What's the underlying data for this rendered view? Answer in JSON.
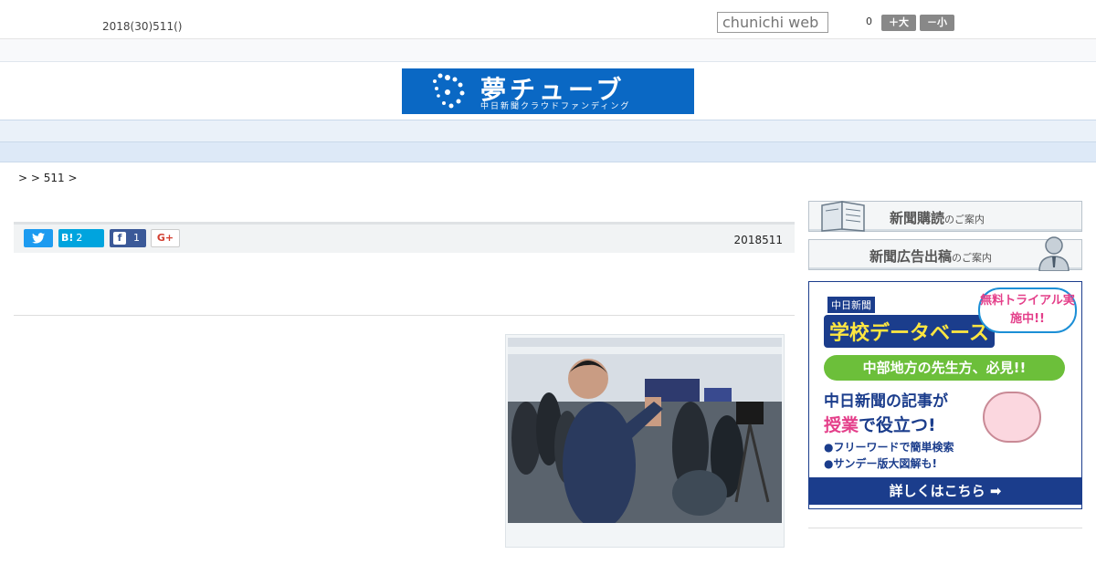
{
  "header": {
    "date": "2018(30)511()",
    "search_placeholder": "chunichi web",
    "font_size_value": "0",
    "size_large_label": "＋大",
    "size_small_label": "－小"
  },
  "banner": {
    "title": "夢チューブ",
    "subtitle": "中日新聞クラウドファンディング"
  },
  "nav": {
    "items": [
      "",
      "",
      "",
      "",
      "",
      "",
      "",
      "",
      ""
    ]
  },
  "breadcrumb": ">  > 511 >",
  "share": {
    "twitter_icon": "twitter-icon",
    "hatena_label": "B!",
    "hatena_count": "2",
    "facebook_count": "1",
    "google_label": "G+"
  },
  "article": {
    "date": "2018511"
  },
  "sidebar": {
    "subscribe_title": "新聞購読",
    "subscribe_suffix": "のご案内",
    "ad_title": "新聞広告出稿",
    "ad_suffix": "のご案内"
  },
  "ad": {
    "brand": "中日新聞",
    "title": "学校データベース",
    "bubble": "無料トライアル実施中!!",
    "green": "中部地方の先生方、必見!!",
    "line1": "中日新聞の記事が",
    "line2_hl": "授業",
    "line2_rest": "で役立つ!",
    "bullet1": "●フリーワードで簡単検索",
    "bullet2": "●サンデー版大図解も!",
    "cta": "詳しくはこちら ➡"
  },
  "colors": {
    "banner_blue": "#0a68c4",
    "nav_bg": "#eaf1f9",
    "ad_navy": "#1b3d8c",
    "ad_pink": "#e43f8a"
  }
}
